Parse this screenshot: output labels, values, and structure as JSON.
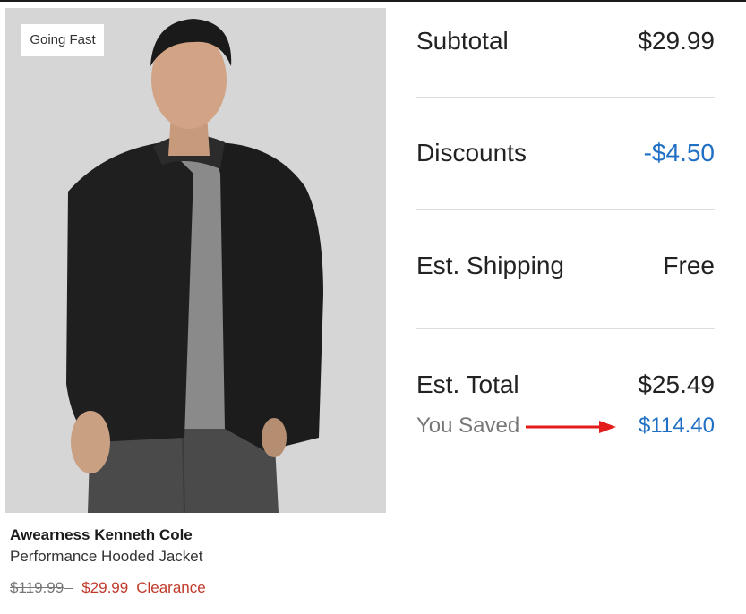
{
  "product": {
    "badge": "Going Fast",
    "brand": "Awearness Kenneth Cole",
    "name": "Performance Hooded Jacket",
    "price_original": "$119.99",
    "price_sale": "$29.99",
    "price_tag": "Clearance"
  },
  "summary": {
    "subtotal_label": "Subtotal",
    "subtotal_value": "$29.99",
    "discounts_label": "Discounts",
    "discounts_value": "-$4.50",
    "shipping_label": "Est. Shipping",
    "shipping_value": "Free",
    "total_label": "Est. Total",
    "total_value": "$25.49",
    "saved_label": "You Saved",
    "saved_value": "$114.40"
  },
  "colors": {
    "sale_red": "#c0392b",
    "link_blue": "#1f6fc5",
    "annotation_arrow": "#e31b1b"
  }
}
